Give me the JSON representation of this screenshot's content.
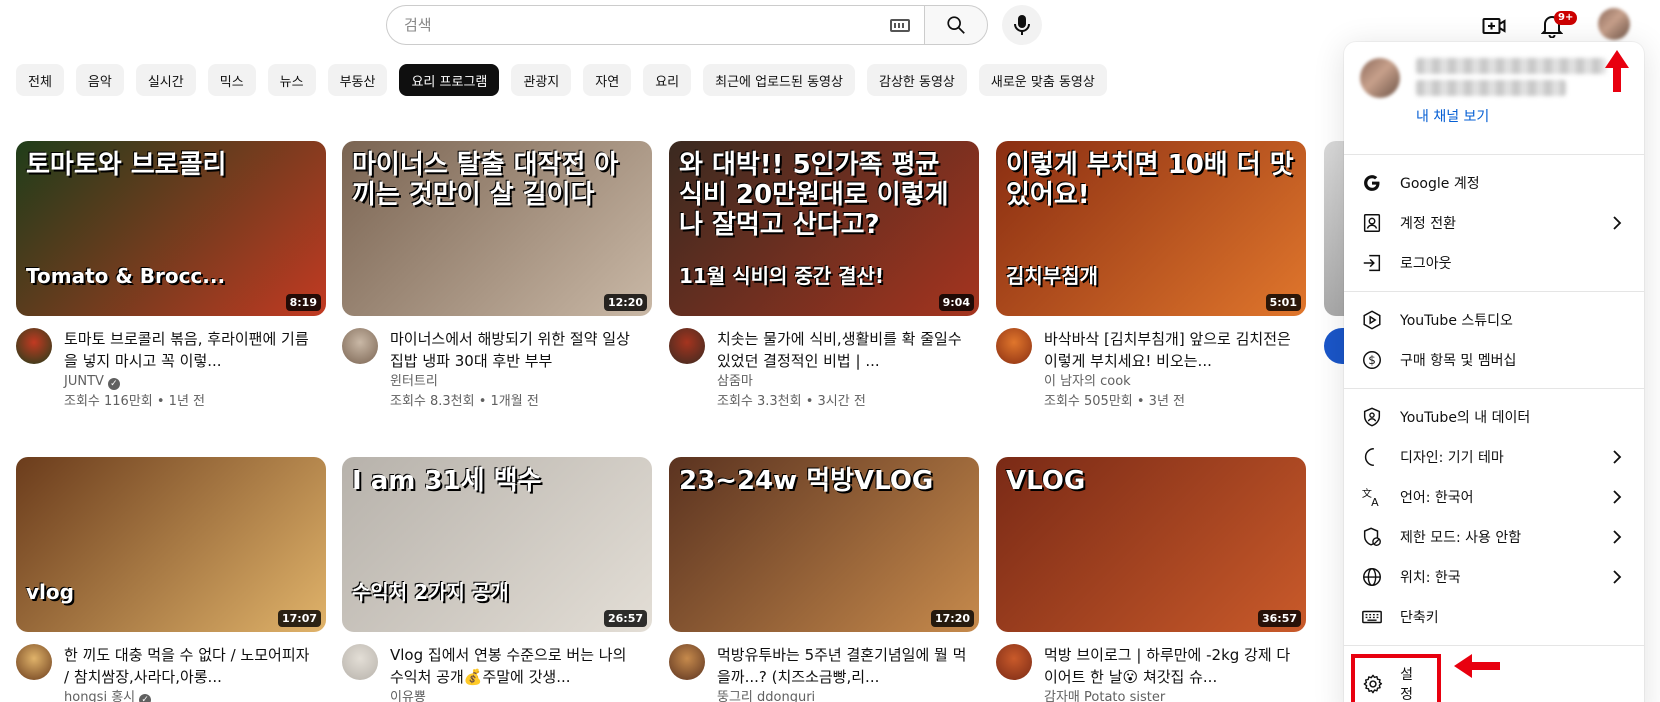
{
  "search": {
    "placeholder": "검색",
    "value": ""
  },
  "notifications": {
    "count": "9+"
  },
  "chips": [
    "전체",
    "음악",
    "실시간",
    "믹스",
    "뉴스",
    "부동산",
    "요리 프로그램",
    "관광지",
    "자연",
    "요리",
    "최근에 업로드된 동영상",
    "감상한 동영상",
    "새로운 맞춤 동영상"
  ],
  "active_chip": "요리 프로그램",
  "videos": [
    {
      "thumb_text": "토마토와 브로콜리",
      "thumb_sub": "Tomato & Brocc...",
      "duration": "8:19",
      "title": "토마토 브로콜리 볶음, 후라이팬에 기름을 넣지 마시고 꼭 이렇...",
      "channel": "JUNTV",
      "verified": true,
      "stats": "조회수 116만회 • 1년 전",
      "colors": [
        "#1f3d1a",
        "#c23a22"
      ]
    },
    {
      "thumb_text": "마이너스 탈출 대작전 아끼는 것만이 살 길이다",
      "thumb_sub": "",
      "duration": "12:20",
      "title": "마이너스에서 해방되기 위한 절약 일상 집밥 냉파 30대 후반 부부",
      "channel": "윈터트리",
      "verified": false,
      "stats": "조회수 8.3천회 • 1개월 전",
      "colors": [
        "#7a6452",
        "#c9b8a6"
      ]
    },
    {
      "thumb_text": "와 대박!! 5인가족 평균 식비 20만원대로 이렇게나 잘먹고 산다고?",
      "thumb_sub": "11월 식비의 중간 결산!",
      "duration": "9:04",
      "title": "치솟는 물가에 식비,생활비를 확 줄일수 있었던 결정적인 비법 | ...",
      "channel": "삼줌마",
      "verified": false,
      "stats": "조회수 3.3천회 • 3시간 전",
      "colors": [
        "#3a2a20",
        "#a5341f"
      ]
    },
    {
      "thumb_text": "이렇게 부치면 10배 더 맛있어요!",
      "thumb_sub": "김치부침개",
      "duration": "5:01",
      "title": "바삭바삭 [김치부침개] 앞으로 김치전은 이렇게 부치세요! 비오는...",
      "channel": "이 남자의 cook",
      "verified": false,
      "stats": "조회수 505만회 • 3년 전",
      "colors": [
        "#8a2e12",
        "#e0762c"
      ]
    },
    {
      "thumb_text": "",
      "thumb_sub": "vlog",
      "duration": "17:07",
      "title": "한 끼도 대충 먹을 수 없다 / 노모어피자 / 참치쌈장,사라다,아롱...",
      "channel": "hongsi 홍시",
      "verified": true,
      "stats": "",
      "colors": [
        "#6b3c1c",
        "#e0b36a"
      ]
    },
    {
      "thumb_text": "I am 31세 백수",
      "thumb_sub": "수익처 2가지 공개",
      "duration": "26:57",
      "title": "Vlog 집에서 연봉 수준으로 버는 나의 수익처 공개💰주말에 갓생...",
      "channel": "이유뿅",
      "verified": false,
      "stats": "",
      "colors": [
        "#b7b2ab",
        "#e3ded6"
      ]
    },
    {
      "thumb_text": "23~24w 먹방VLOG",
      "thumb_sub": "",
      "duration": "17:20",
      "title": "먹방유투바는 5주년 결혼기념일에 뭘 먹을까...? (치즈소금빵,리...",
      "channel": "뚱그리 ddonguri",
      "verified": false,
      "stats": "",
      "colors": [
        "#5b3320",
        "#c68a4c"
      ]
    },
    {
      "thumb_text": "VLOG",
      "thumb_sub": "",
      "duration": "36:57",
      "title": "먹방 브이로그 | 하루만에 -2kg 강제 다이어트 한 날😮 쳐갓집 슈...",
      "channel": "감자매 Potato sister",
      "verified": false,
      "stats": "",
      "colors": [
        "#7a2a16",
        "#c95a2a"
      ]
    }
  ],
  "menu": {
    "channel_link": "내 채널 보기",
    "groups": [
      [
        {
          "icon": "google-icon",
          "label": "Google 계정",
          "chevron": false
        },
        {
          "icon": "switch-account-icon",
          "label": "계정 전환",
          "chevron": true
        },
        {
          "icon": "sign-out-icon",
          "label": "로그아웃",
          "chevron": false
        }
      ],
      [
        {
          "icon": "studio-icon",
          "label": "YouTube 스튜디오",
          "chevron": false
        },
        {
          "icon": "dollar-icon",
          "label": "구매 항목 및 멤버십",
          "chevron": false
        }
      ],
      [
        {
          "icon": "shield-person-icon",
          "label": "YouTube의 내 데이터",
          "chevron": false
        },
        {
          "icon": "moon-icon",
          "label": "디자인: 기기 테마",
          "chevron": true
        },
        {
          "icon": "translate-icon",
          "label": "언어: 한국어",
          "chevron": true
        },
        {
          "icon": "restricted-icon",
          "label": "제한 모드: 사용 안함",
          "chevron": true
        },
        {
          "icon": "globe-icon",
          "label": "위치: 한국",
          "chevron": true
        },
        {
          "icon": "keyboard-icon",
          "label": "단축키",
          "chevron": false
        }
      ]
    ],
    "settings_label": "설정"
  },
  "colors": {
    "annotation": "#e8000f",
    "link": "#065fd4"
  }
}
